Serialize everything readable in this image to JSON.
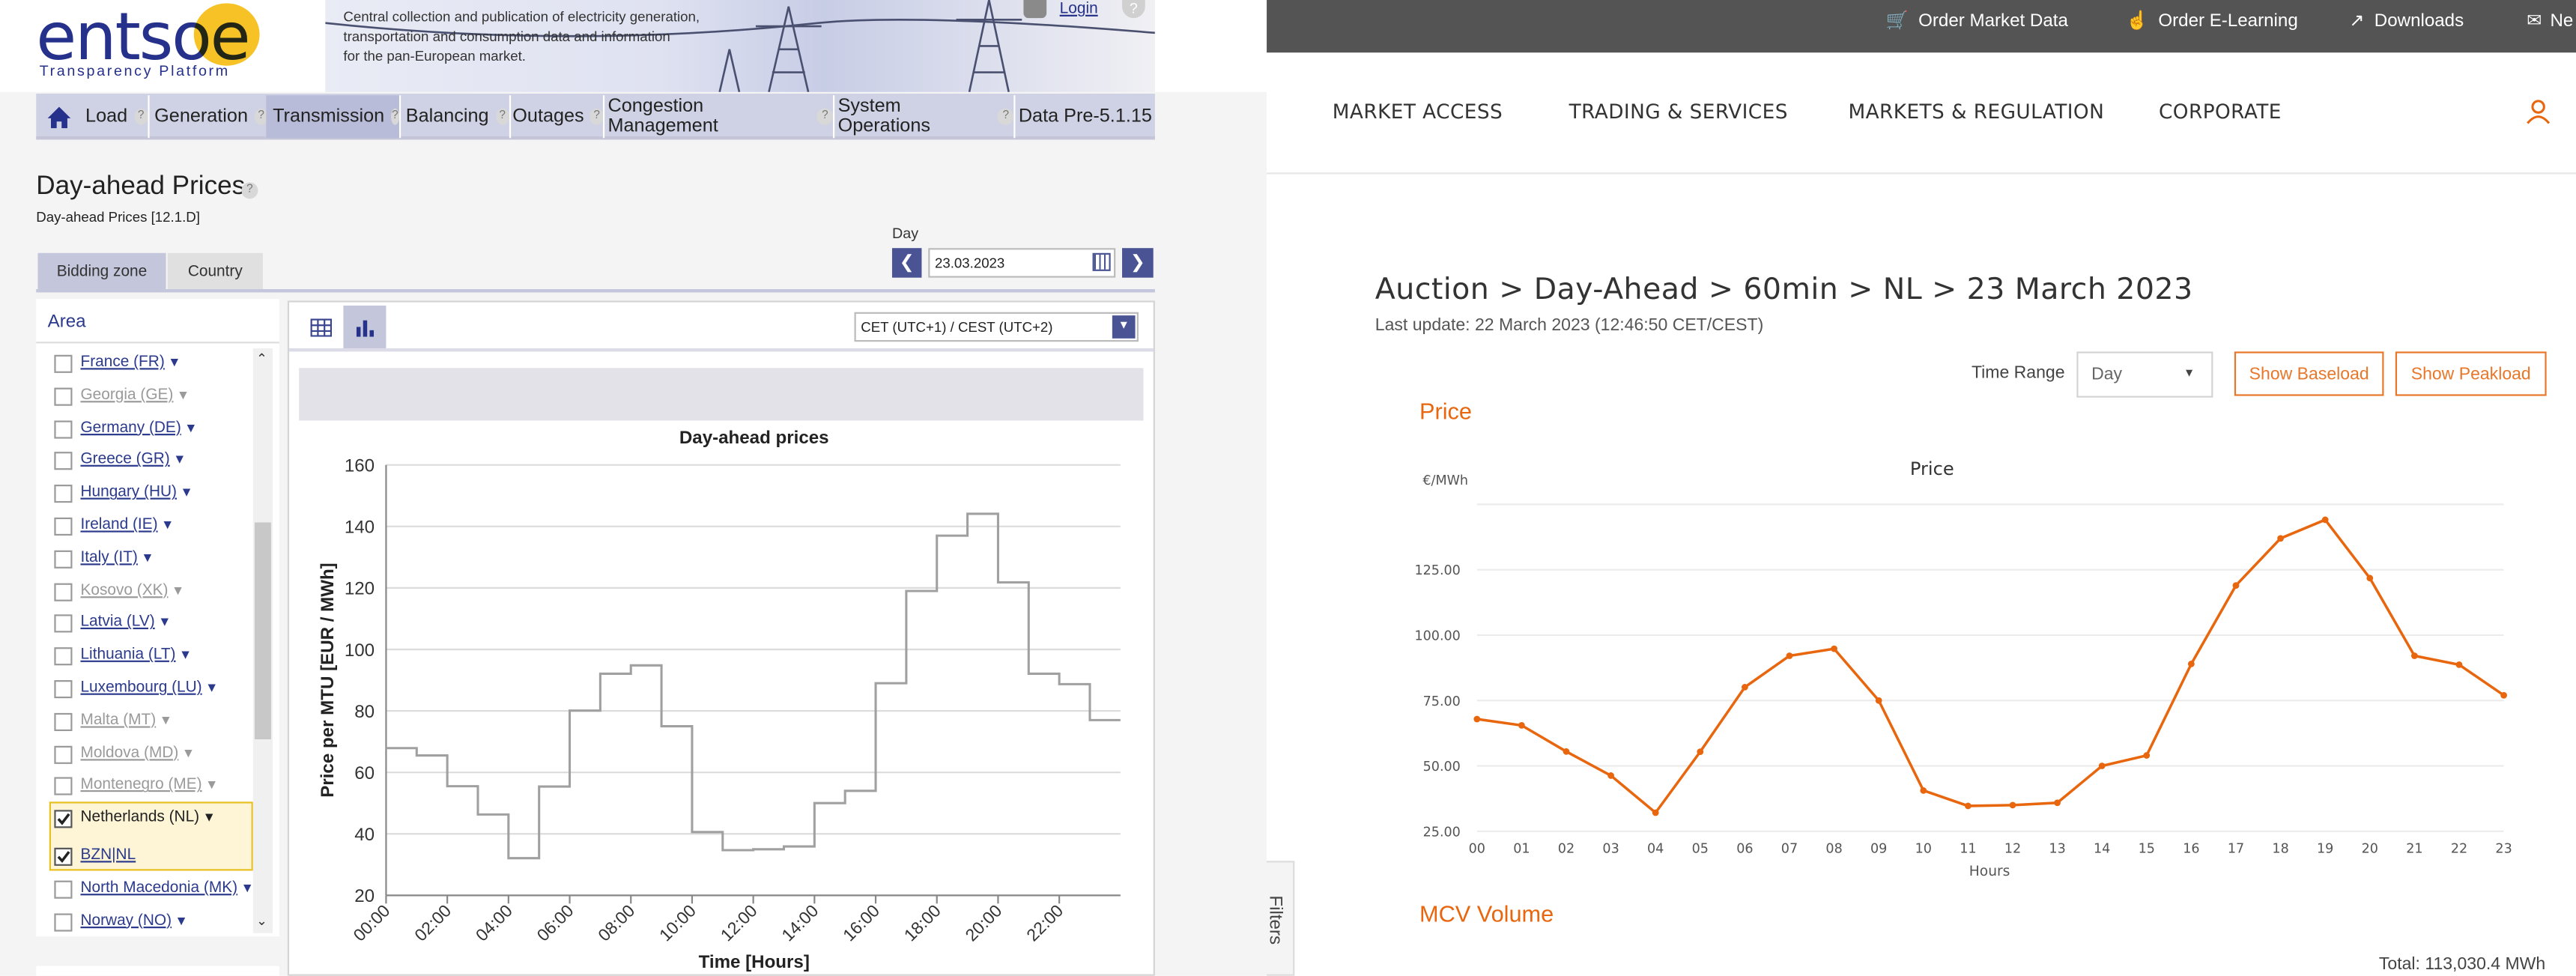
{
  "left": {
    "logo": {
      "text": "entsoe",
      "sub": "Transparency Platform"
    },
    "tagline": [
      "Central collection and publication of electricity generation,",
      "transportation and consumption data and information",
      "for the pan-European market."
    ],
    "login": "Login",
    "nav": [
      {
        "label": "Load",
        "q": "?"
      },
      {
        "label": "Generation",
        "q": "?"
      },
      {
        "label": "Transmission",
        "q": "?"
      },
      {
        "label": "Balancing",
        "q": "?"
      },
      {
        "label": "Outages",
        "q": "?"
      },
      {
        "label": "Congestion Management",
        "q": "?"
      },
      {
        "label": "System Operations",
        "q": "?"
      },
      {
        "label": "Data Pre-5.1.15",
        "q": ""
      }
    ],
    "page_title": "Day-ahead Prices",
    "page_subtitle": "Day-ahead Prices [12.1.D]",
    "tabs": [
      "Bidding zone",
      "Country"
    ],
    "day_label": "Day",
    "day_value": "23.03.2023",
    "area_label": "Area",
    "timezone": "CET (UTC+1) / CEST (UTC+2)",
    "areas": [
      {
        "label": "France (FR)",
        "enabled": true,
        "checked": false
      },
      {
        "label": "Georgia (GE)",
        "enabled": false,
        "checked": false
      },
      {
        "label": "Germany (DE)",
        "enabled": true,
        "checked": false
      },
      {
        "label": "Greece (GR)",
        "enabled": true,
        "checked": false
      },
      {
        "label": "Hungary (HU)",
        "enabled": true,
        "checked": false
      },
      {
        "label": "Ireland (IE)",
        "enabled": true,
        "checked": false
      },
      {
        "label": "Italy (IT)",
        "enabled": true,
        "checked": false
      },
      {
        "label": "Kosovo (XK)",
        "enabled": false,
        "checked": false
      },
      {
        "label": "Latvia (LV)",
        "enabled": true,
        "checked": false
      },
      {
        "label": "Lithuania (LT)",
        "enabled": true,
        "checked": false
      },
      {
        "label": "Luxembourg (LU)",
        "enabled": true,
        "checked": false
      },
      {
        "label": "Malta (MT)",
        "enabled": false,
        "checked": false
      },
      {
        "label": "Moldova (MD)",
        "enabled": false,
        "checked": false
      },
      {
        "label": "Montenegro (ME)",
        "enabled": false,
        "checked": false
      },
      {
        "label": "Netherlands (NL)",
        "enabled": true,
        "checked": true
      },
      {
        "label": "BZN|NL",
        "enabled": true,
        "checked": true
      },
      {
        "label": "North Macedonia (MK)",
        "enabled": true,
        "checked": false
      },
      {
        "label": "Norway (NO)",
        "enabled": true,
        "checked": false
      }
    ]
  },
  "right": {
    "toplinks": [
      "Order Market Data",
      "Order E-Learning",
      "Downloads",
      "Ne"
    ],
    "nav": [
      "MARKET ACCESS",
      "TRADING & SERVICES",
      "MARKETS & REGULATION",
      "CORPORATE"
    ],
    "breadcrumb": "Auction > Day-Ahead > 60min > NL > 23 March 2023",
    "last_update": "Last update: 22 March 2023 (12:46:50 CET/CEST)",
    "time_range_label": "Time Range",
    "time_range_value": "Day",
    "btn_baseload": "Show Baseload",
    "btn_peakload": "Show Peakload",
    "section_price": "Price",
    "section_mcv": "MCV Volume",
    "filters": "Filters",
    "total": "Total: 113,030.4 MWh"
  },
  "chart_data": [
    {
      "type": "line",
      "step": true,
      "title": "Day-ahead prices",
      "xlabel": "Time [Hours]",
      "ylabel": "Price per MTU [EUR / MWh]",
      "ylim": [
        20,
        160
      ],
      "yticks": [
        20,
        40,
        60,
        80,
        100,
        120,
        140,
        160
      ],
      "xticklabels": [
        "00:00",
        "02:00",
        "04:00",
        "06:00",
        "08:00",
        "10:00",
        "12:00",
        "14:00",
        "16:00",
        "18:00",
        "20:00",
        "22:00"
      ],
      "x": [
        0,
        1,
        2,
        3,
        4,
        5,
        6,
        7,
        8,
        9,
        10,
        11,
        12,
        13,
        14,
        15,
        16,
        17,
        18,
        19,
        20,
        21,
        22,
        23
      ],
      "values": [
        67.9,
        65.5,
        55.5,
        46.3,
        32.1,
        55.4,
        80.1,
        92.1,
        94.8,
        75.0,
        40.6,
        34.7,
        35.0,
        35.9,
        50.0,
        54.0,
        89.0,
        119.0,
        137.0,
        144.1,
        121.8,
        92.1,
        88.7,
        77.0
      ],
      "series_color": "#a0a0a0",
      "grid": true
    },
    {
      "type": "line",
      "title": "Price",
      "ylabel": "€/MWh",
      "xlabel": "Hours",
      "ylim": [
        25,
        150
      ],
      "yticks": [
        "25.00",
        "50.00",
        "75.00",
        "100.00",
        "125.00"
      ],
      "x": [
        "00",
        "01",
        "02",
        "03",
        "04",
        "05",
        "06",
        "07",
        "08",
        "09",
        "10",
        "11",
        "12",
        "13",
        "14",
        "15",
        "16",
        "17",
        "18",
        "19",
        "20",
        "21",
        "22",
        "23"
      ],
      "values": [
        67.9,
        65.5,
        55.5,
        46.3,
        32.1,
        55.4,
        80.1,
        92.1,
        94.8,
        75.0,
        40.6,
        34.7,
        35.0,
        35.9,
        50.0,
        54.0,
        89.0,
        119.0,
        137.0,
        144.1,
        121.8,
        92.1,
        88.7,
        77.0
      ],
      "series_color": "#e8660e",
      "grid": true
    }
  ]
}
